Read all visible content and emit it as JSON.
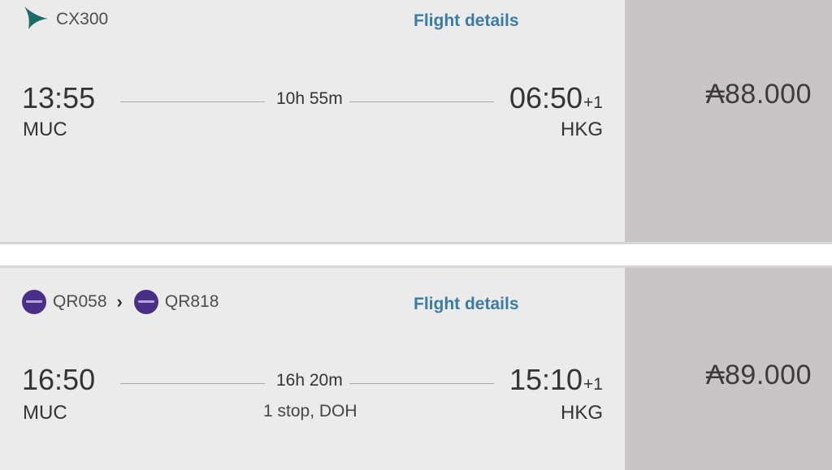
{
  "results": [
    {
      "flights": [
        {
          "number": "CX300",
          "airline_icon": "cathay-pacific-logo-icon"
        }
      ],
      "details_label": "Flight details",
      "departure": {
        "time": "13:55",
        "airport": "MUC"
      },
      "arrival": {
        "time": "06:50",
        "day_offset": "+1",
        "airport": "HKG"
      },
      "duration": "10h 55m",
      "stops": "",
      "price": "₳88.000"
    },
    {
      "flights": [
        {
          "number": "QR058",
          "airline_icon": "qatar-airways-logo-icon"
        },
        {
          "number": "QR818",
          "airline_icon": "qatar-airways-logo-icon"
        }
      ],
      "details_label": "Flight details",
      "departure": {
        "time": "16:50",
        "airport": "MUC"
      },
      "arrival": {
        "time": "15:10",
        "day_offset": "+1",
        "airport": "HKG"
      },
      "duration": "16h 20m",
      "stops": "1 stop, DOH",
      "price": "₳89.000"
    }
  ],
  "colors": {
    "card_bg": "#ebebeb",
    "price_panel_bg": "#c9c4c5",
    "link": "#3a7ca5",
    "cathay_green": "#1d6b68",
    "qatar_purple": "#4a2f88"
  }
}
